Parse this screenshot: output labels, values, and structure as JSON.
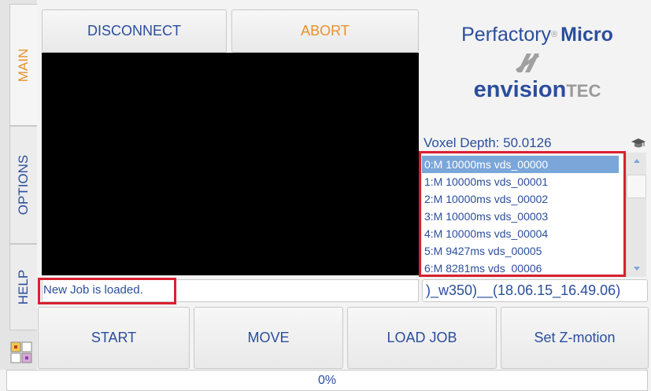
{
  "tabs": {
    "main": "MAIN",
    "options": "OPTIONS",
    "help": "HELP"
  },
  "top_buttons": {
    "disconnect": "DISCONNECT",
    "abort": "ABORT"
  },
  "brand": {
    "product": "Perfactory",
    "registered": "®",
    "micro": "Micro",
    "company_main": "envision",
    "company_suffix": "TEC"
  },
  "voxel_depth_label": "Voxel Depth: 50.0126",
  "layers": [
    "0:M 10000ms vds_00000",
    "1:M 10000ms vds_00001",
    "2:M 10000ms vds_00002",
    "3:M 10000ms vds_00003",
    "4:M 10000ms vds_00004",
    "5:M 9427ms vds_00005",
    "6:M 8281ms vds_00006"
  ],
  "status_message": "New Job is loaded.",
  "job_name": ")_w350)__(18.06.15_16.49.06)",
  "bottom_buttons": {
    "start": "START",
    "move": "MOVE",
    "load_job": "LOAD JOB",
    "set_z_motion": "Set Z-motion"
  },
  "progress": {
    "percent_text": "0%",
    "value": 0
  },
  "colors": {
    "accent_blue": "#2b4e9c",
    "highlight_red": "#d9202f",
    "abort_orange": "#e8912c",
    "selection_blue": "#7aa6d9"
  }
}
